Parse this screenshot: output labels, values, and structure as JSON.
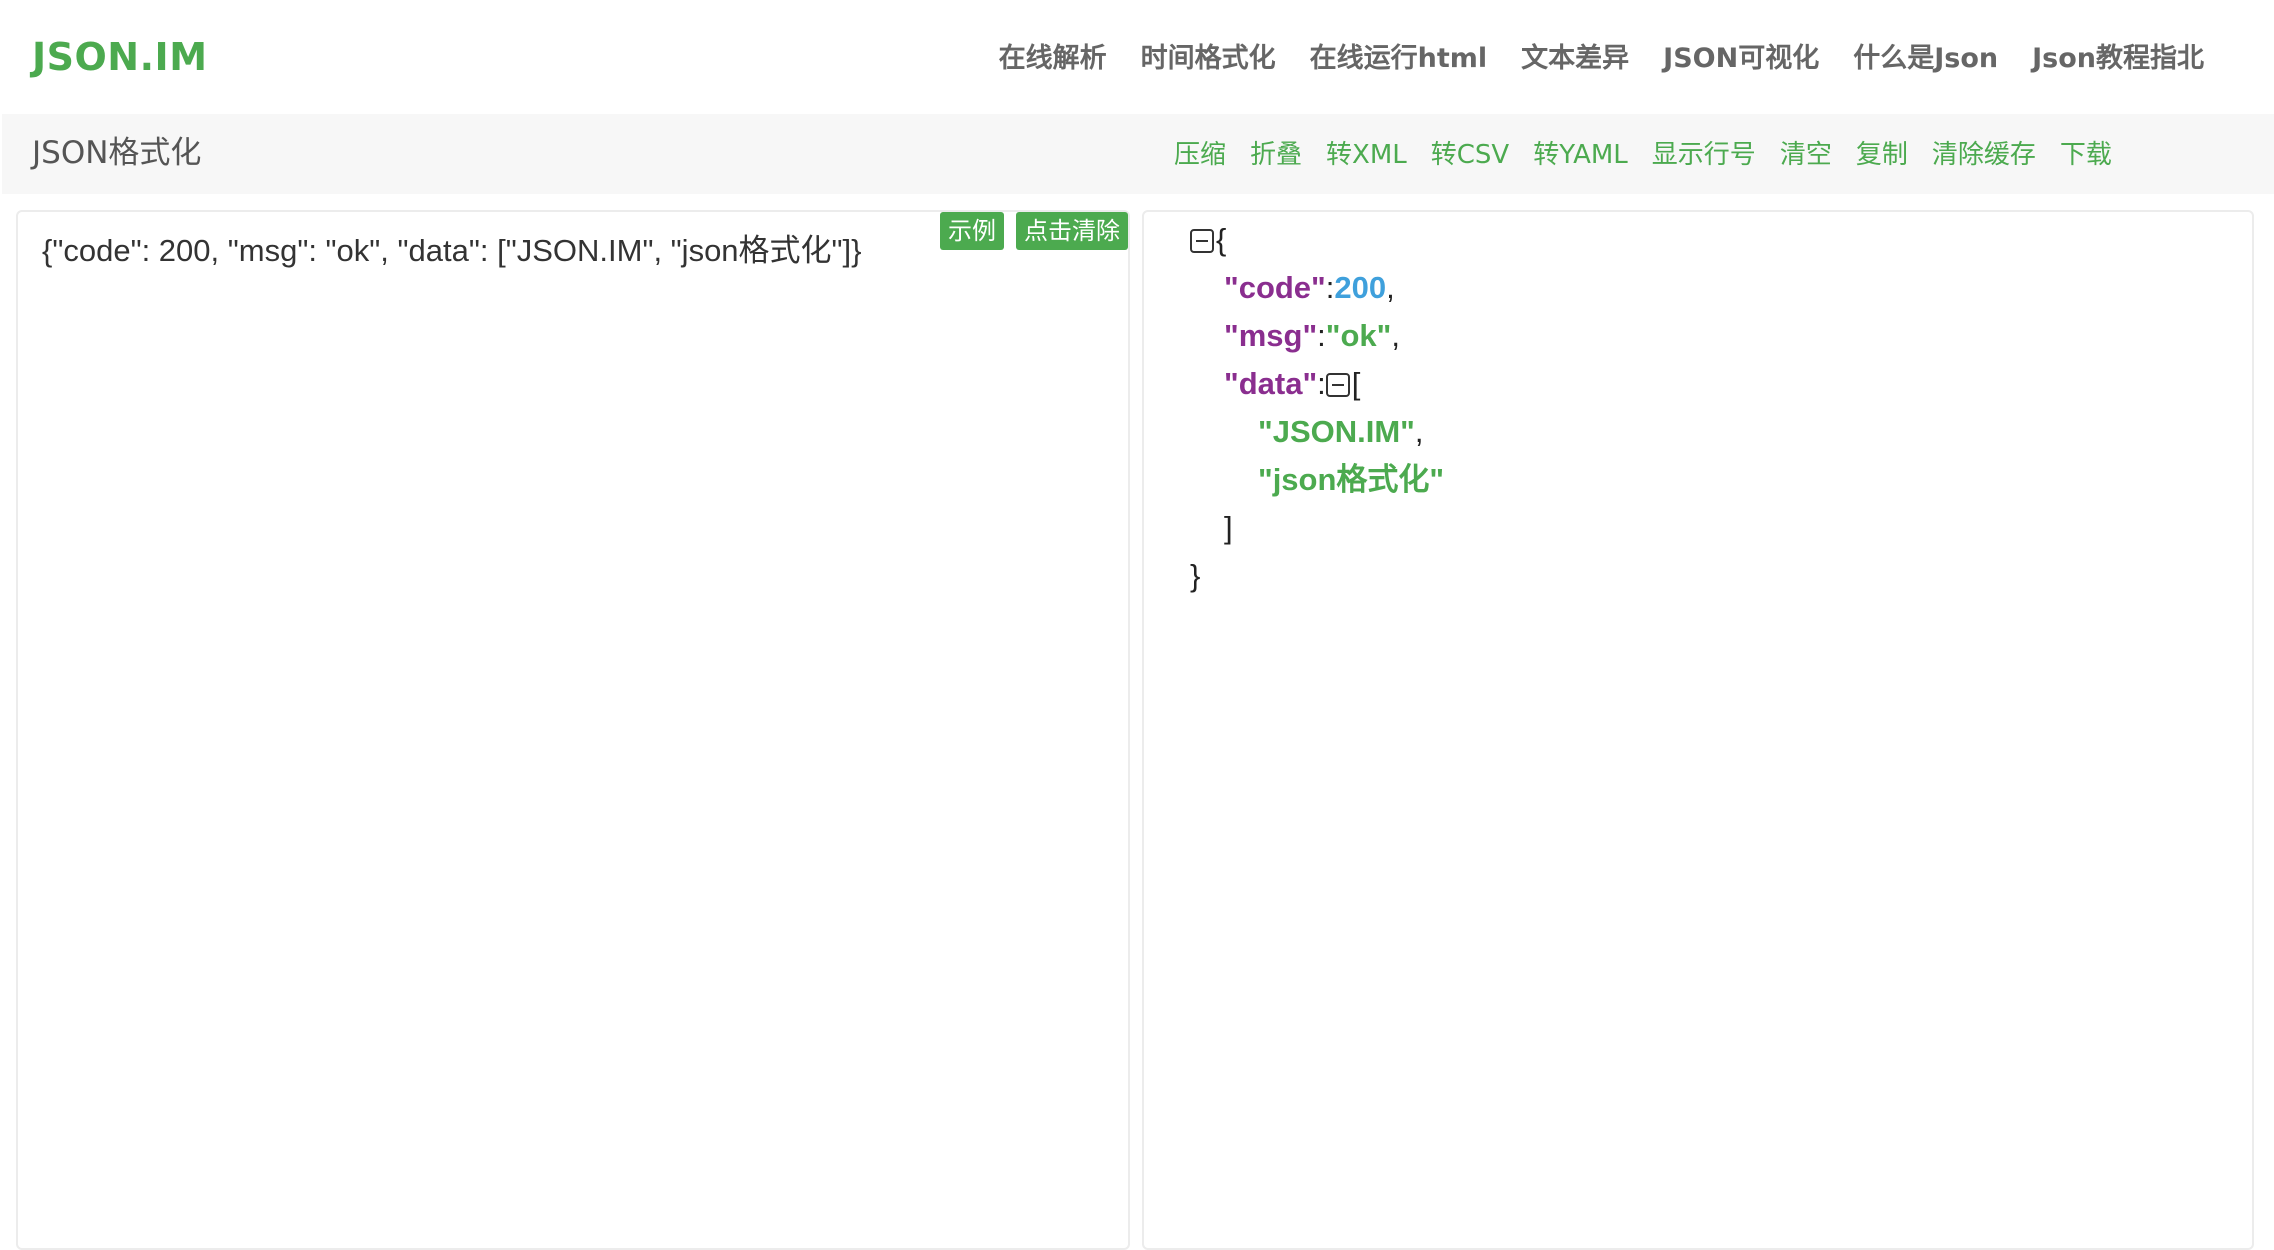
{
  "header": {
    "logo": "JSON.IM",
    "nav": [
      "在线解析",
      "时间格式化",
      "在线运行html",
      "文本差异",
      "JSON可视化",
      "什么是Json",
      "Json教程指北"
    ]
  },
  "subbar": {
    "title": "JSON格式化",
    "tools": [
      "压缩",
      "折叠",
      "转XML",
      "转CSV",
      "转YAML",
      "显示行号",
      "清空",
      "复制",
      "清除缓存",
      "下载"
    ]
  },
  "editor": {
    "input_value": "{\"code\": 200, \"msg\": \"ok\", \"data\": [\"JSON.IM\", \"json格式化\"]}",
    "example_button": "示例",
    "clear_button": "点击清除"
  },
  "tree": {
    "open_brace": "{",
    "close_brace": "}",
    "open_bracket": "[",
    "close_bracket": "]",
    "colon": ":",
    "comma": ",",
    "code_key": "\"code\"",
    "code_value": "200",
    "msg_key": "\"msg\"",
    "msg_value": "\"ok\"",
    "data_key": "\"data\"",
    "data_item_1": "\"JSON.IM\"",
    "data_item_2": "\"json格式化\""
  },
  "colors": {
    "accent": "#4caa4f",
    "key": "#8a2e8f",
    "number": "#3fa0dc",
    "string": "#4caa4f"
  }
}
